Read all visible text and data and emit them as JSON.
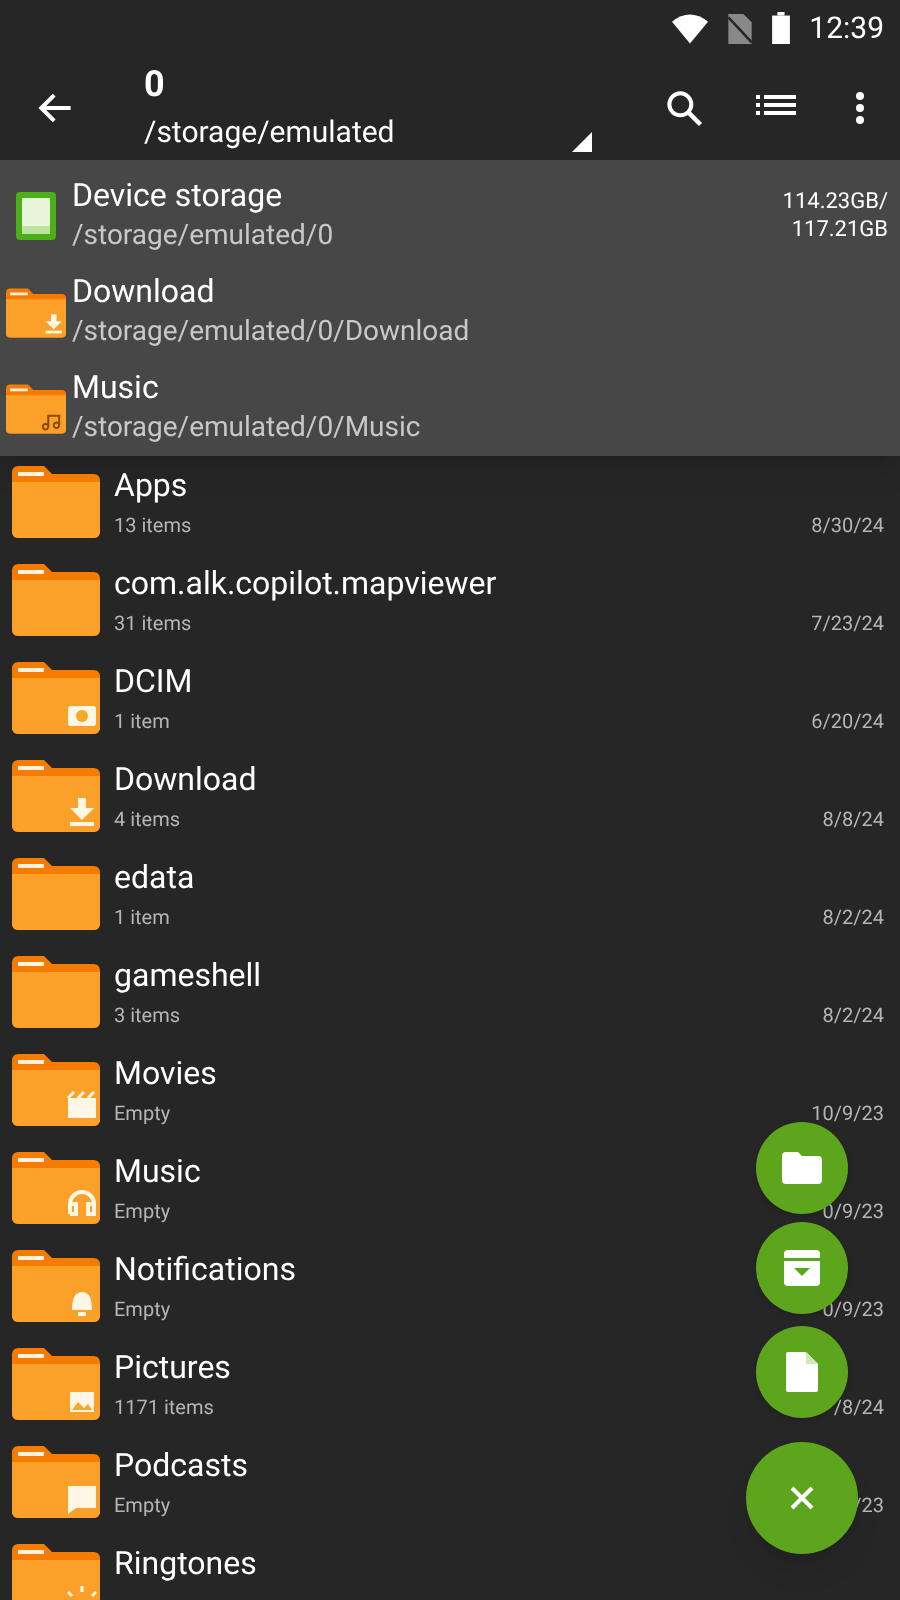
{
  "status_bar": {
    "time": "12:39"
  },
  "toolbar": {
    "title": "0",
    "path": "/storage/emulated"
  },
  "dropdown": [
    {
      "kind": "storage",
      "name": "Device storage",
      "path": "/storage/emulated/0",
      "size": "114.23GB/\n117.21GB"
    },
    {
      "kind": "folder",
      "name": "Download",
      "path": "/storage/emulated/0/Download"
    },
    {
      "kind": "folder",
      "name": "Music",
      "path": "/storage/emulated/0/Music"
    }
  ],
  "files": [
    {
      "name": "Apps",
      "info": "13 items",
      "date": "8/30/24"
    },
    {
      "name": "com.alk.copilot.mapviewer",
      "info": "31 items",
      "date": "7/23/24"
    },
    {
      "name": "DCIM",
      "info": "1 item",
      "date": "6/20/24"
    },
    {
      "name": "Download",
      "info": "4 items",
      "date": "8/8/24"
    },
    {
      "name": "edata",
      "info": "1 item",
      "date": "8/2/24"
    },
    {
      "name": "gameshell",
      "info": "3 items",
      "date": "8/2/24"
    },
    {
      "name": "Movies",
      "info": "Empty",
      "date": "10/9/23"
    },
    {
      "name": "Music",
      "info": "Empty",
      "date": "0/9/23"
    },
    {
      "name": "Notifications",
      "info": "Empty",
      "date": "0/9/23"
    },
    {
      "name": "Pictures",
      "info": "1171 items",
      "date": "/8/24"
    },
    {
      "name": "Podcasts",
      "info": "Empty",
      "date": "/23"
    },
    {
      "name": "Ringtones"
    }
  ]
}
